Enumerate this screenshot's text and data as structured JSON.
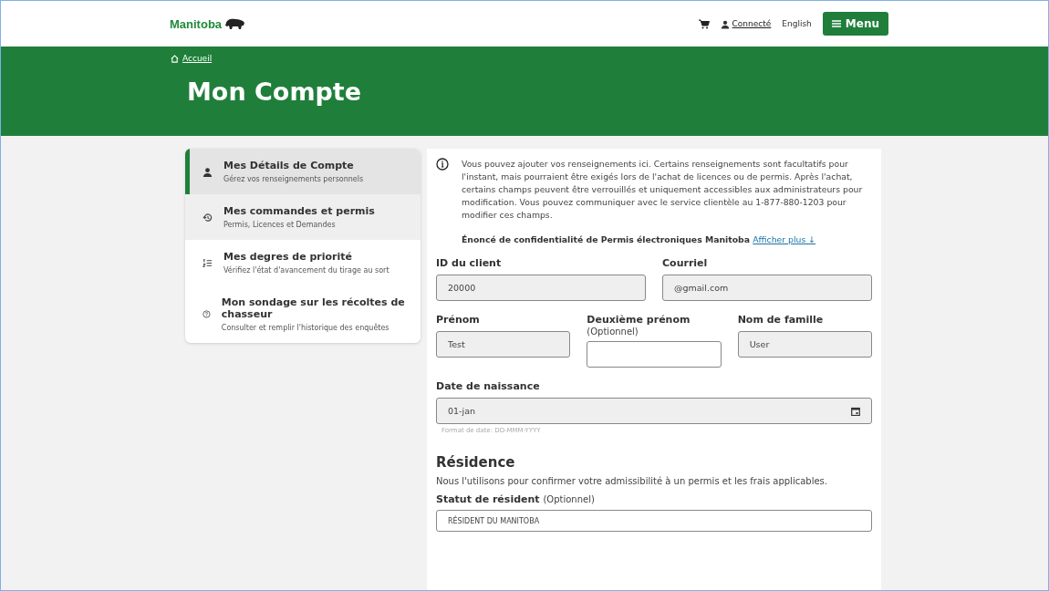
{
  "header": {
    "logo": "Manitoba",
    "account_link": "Connecté",
    "language": "English",
    "menu_button": "Menu"
  },
  "breadcrumb": "Accueil",
  "page_title": "Mon Compte",
  "sidebar": {
    "items": [
      {
        "title": "Mes Détails de Compte",
        "subtitle": "Gérez vos renseignements personnels",
        "kind": "person",
        "selected": true,
        "highlighted": false
      },
      {
        "title": "Mes commandes et permis",
        "subtitle": "Permis, Licences et Demandes",
        "kind": "history",
        "selected": false,
        "highlighted": true
      },
      {
        "title": "Mes degres de priorité",
        "subtitle": "Vérifiez l'état d'avancement du tirage au sort",
        "kind": "list",
        "selected": false,
        "highlighted": false
      },
      {
        "title": "Mon sondage sur les récoltes de chasseur",
        "subtitle": "Consulter et remplir l'historique des enquêtes",
        "kind": "help",
        "selected": false,
        "highlighted": false
      }
    ]
  },
  "info": {
    "text": "Vous pouvez ajouter vos renseignements ici. Certains renseignements sont facultatifs pour l'instant, mais pourraient être exigés lors de l'achat de licences ou de permis. Après l'achat, certains champs peuvent être verrouillés et uniquement accessibles aux administrateurs pour modification. Vous pouvez communiquer avec le service clientèle au 1-877-880-1203 pour modifier ces champs.",
    "privacy": "Énoncé de confidentialité de Permis électroniques Manitoba",
    "privacy_link": "Afficher plus ↓"
  },
  "form_rows": [
    [
      {
        "label": "ID du client",
        "value": "20000",
        "disabled": true
      },
      {
        "label": "Courriel",
        "value": "@gmail.com",
        "disabled": true
      }
    ],
    [
      {
        "label": "Prénom",
        "value": "Test",
        "disabled": true
      },
      {
        "label": "Deuxième prénom",
        "optional": "(Optionnel)",
        "disabled": false
      },
      {
        "label": "Nom de famille",
        "value": "User",
        "disabled": true
      }
    ]
  ],
  "birth_date": {
    "label": "Date de naissance",
    "value": "01-jan",
    "hint": "Format de date: DD-MMM-YYYY"
  },
  "residence": {
    "heading": "Résidence",
    "description": "Nous l'utilisons pour confirmer votre admissibilité à un permis et les frais applicables.",
    "status_label": "Statut de résident",
    "status_optional": "(Optionnel)",
    "status_value": "RÉSIDENT DU MANITOBA"
  }
}
